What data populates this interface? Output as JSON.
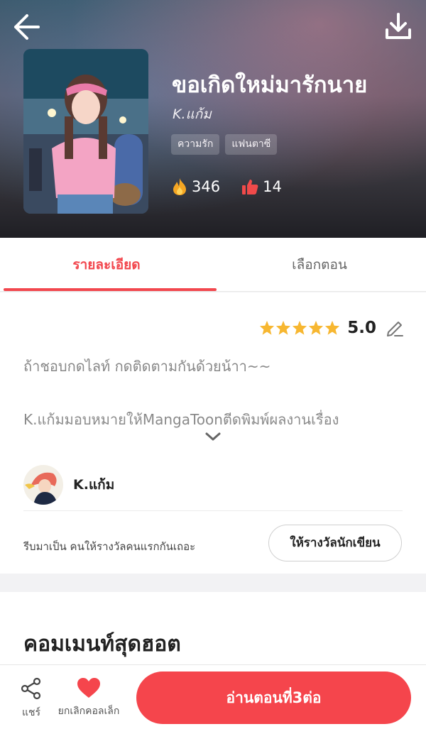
{
  "book": {
    "title": "ขอเกิดใหม่มารักนาย",
    "author": "K.แก้ม",
    "tags": [
      "ความรัก",
      "แฟนตาซี"
    ],
    "views": "346",
    "likes": "14"
  },
  "tabs": {
    "details": "รายละเอียด",
    "episodes": "เลือกตอน"
  },
  "rating": {
    "stars": 5,
    "value": "5.0"
  },
  "description": {
    "line1": "ถ้าชอบกดไลท์  กดติดตามกันด้วยน้าา~~",
    "line2": "K.แก้มมอบหมายให้MangaToonตีดพิมพ์ผลงานเรื่อง"
  },
  "author_section": {
    "name": "K.แก้ม"
  },
  "reward": {
    "prompt": "รีบมาเป็น คนให้รางวัลคนแรกกันเถอะ",
    "button": "ให้รางวัลนักเขียน"
  },
  "comments": {
    "title": "คอมเมนท์สุดฮอต"
  },
  "bottom_bar": {
    "share_label": "แชร์",
    "unfavorite_label": "ยกเลิกคอลเล็ก",
    "read_button": "อ่านตอนที่3ต่อ"
  },
  "colors": {
    "accent": "#f2474e",
    "star": "#f7b731"
  }
}
